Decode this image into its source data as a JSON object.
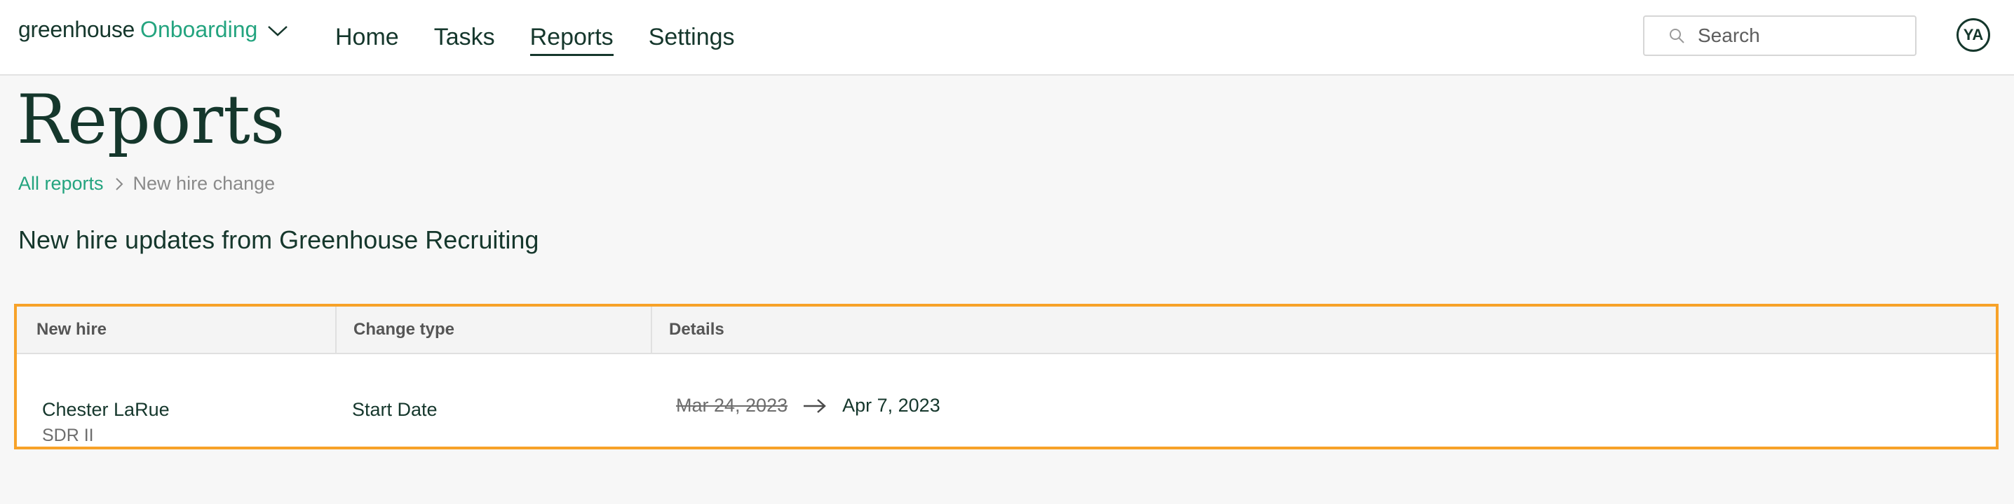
{
  "brand": {
    "wordmark": "greenhouse",
    "product": "Onboarding"
  },
  "nav": {
    "items": [
      {
        "label": "Home",
        "active": false
      },
      {
        "label": "Tasks",
        "active": false
      },
      {
        "label": "Reports",
        "active": true
      },
      {
        "label": "Settings",
        "active": false
      }
    ]
  },
  "search": {
    "placeholder": "Search"
  },
  "user": {
    "initials": "YA"
  },
  "page": {
    "title": "Reports"
  },
  "breadcrumb": {
    "parent": "All reports",
    "current": "New hire change"
  },
  "section": {
    "heading": "New hire updates from Greenhouse Recruiting"
  },
  "table": {
    "columns": [
      "New hire",
      "Change type",
      "Details"
    ],
    "rows": [
      {
        "name": "Chester LaRue",
        "role": "SDR II",
        "change_type": "Start Date",
        "old_value": "Mar 24, 2023",
        "new_value": "Apr 7, 2023"
      }
    ]
  },
  "colors": {
    "brand_dark": "#15372c",
    "brand_green": "#24a47f",
    "highlight_border": "#f7a229",
    "background": "#f7f7f7"
  },
  "icons": [
    "chevron-down-icon",
    "search-icon",
    "chevron-right-icon",
    "arrow-right-icon"
  ]
}
